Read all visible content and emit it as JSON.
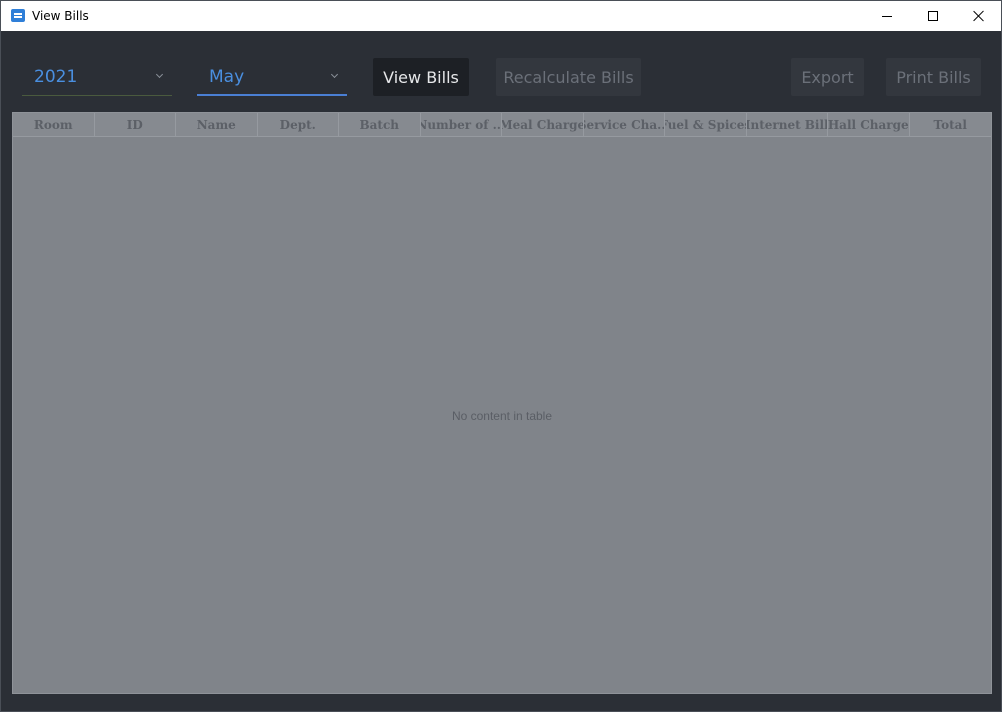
{
  "window": {
    "title": "View Bills",
    "controls": [
      "minimize-icon",
      "maximize-icon",
      "close-icon"
    ]
  },
  "toolbar": {
    "year": {
      "value": "2021"
    },
    "month": {
      "value": "May"
    },
    "view_bills_label": "View Bills",
    "recalculate_label": "Recalculate Bills",
    "export_label": "Export",
    "print_label": "Print Bills"
  },
  "table": {
    "columns": [
      "Room",
      "ID",
      "Name",
      "Dept.",
      "Batch",
      "Number of ...",
      "Meal Charge",
      "Service Cha...",
      "Fuel & Spices",
      "Internet Bill",
      "Hall Charge",
      "Total"
    ],
    "rows": [],
    "empty_text": "No content in table"
  },
  "colors": {
    "background": "#2b2f36",
    "accent": "#4a8fe0",
    "table_bg": "#80848a"
  }
}
